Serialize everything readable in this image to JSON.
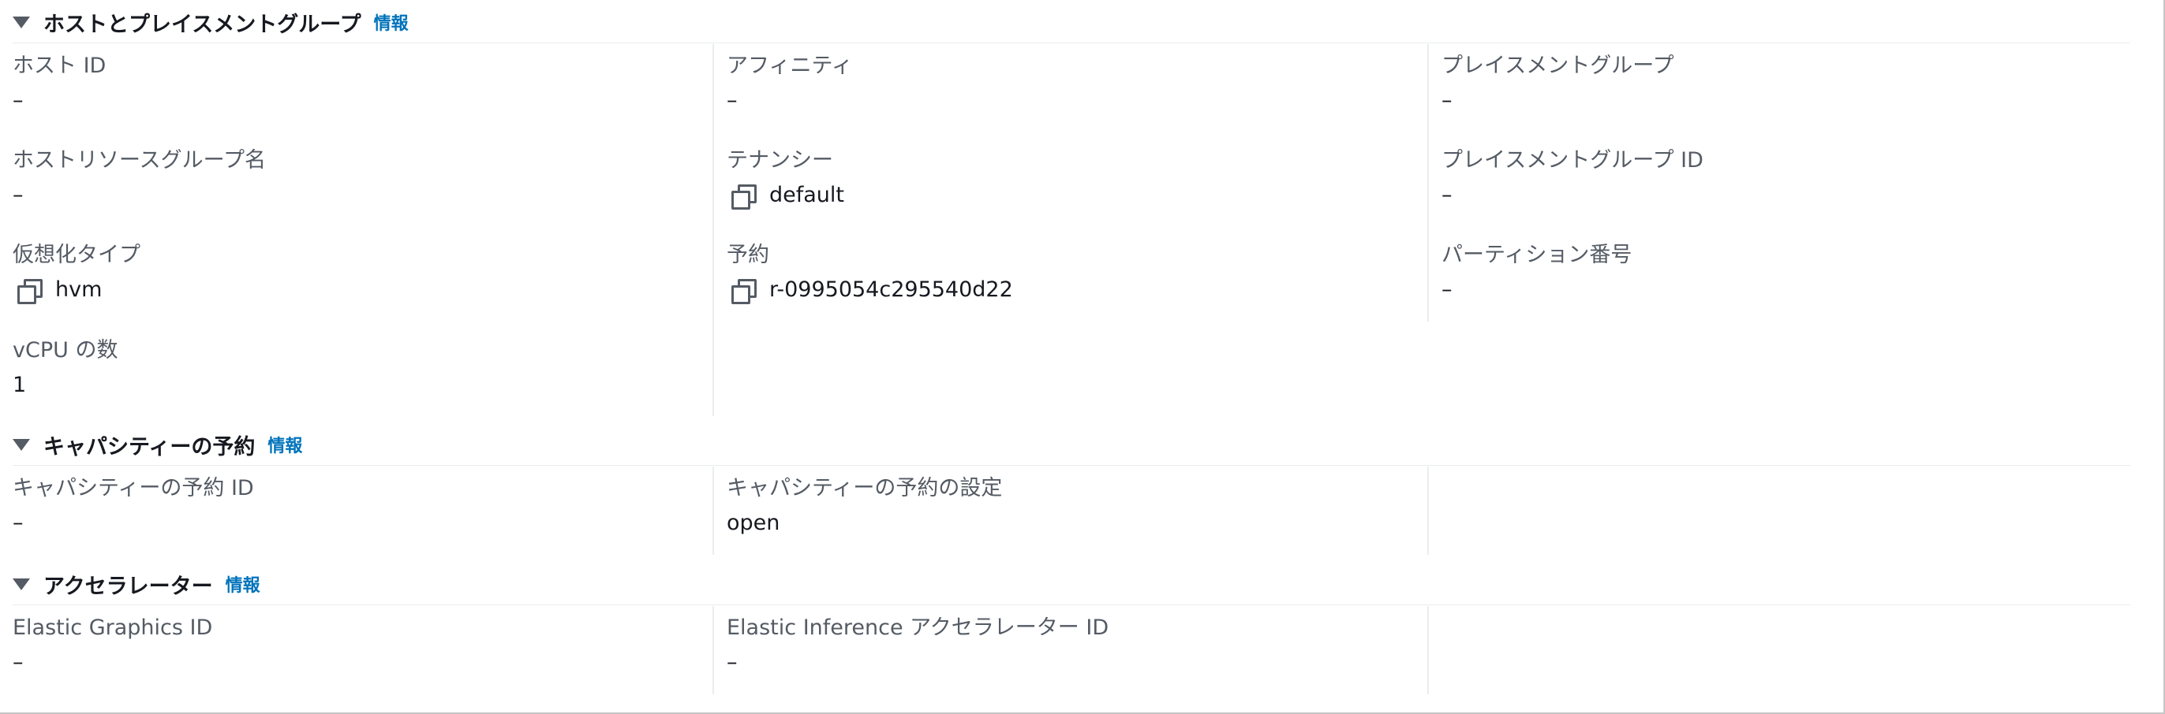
{
  "sections": {
    "host": {
      "title": "ホストとプレイスメントグループ",
      "info": "情報",
      "fields": {
        "host_id": {
          "label": "ホスト ID",
          "value": "–"
        },
        "affinity": {
          "label": "アフィニティ",
          "value": "–"
        },
        "placement_group": {
          "label": "プレイスメントグループ",
          "value": "–"
        },
        "host_resource_group": {
          "label": "ホストリソースグループ名",
          "value": "–"
        },
        "tenancy": {
          "label": "テナンシー",
          "value": "default"
        },
        "placement_group_id": {
          "label": "プレイスメントグループ ID",
          "value": "–"
        },
        "virtualization_type": {
          "label": "仮想化タイプ",
          "value": "hvm"
        },
        "reservation": {
          "label": "予約",
          "value": "r-0995054c295540d22"
        },
        "partition_number": {
          "label": "パーティション番号",
          "value": "–"
        },
        "vcpu_count": {
          "label": "vCPU の数",
          "value": "1"
        }
      }
    },
    "capacity": {
      "title": "キャパシティーの予約",
      "info": "情報",
      "fields": {
        "reservation_id": {
          "label": "キャパシティーの予約 ID",
          "value": "–"
        },
        "reservation_setting": {
          "label": "キャパシティーの予約の設定",
          "value": "open"
        }
      }
    },
    "accelerator": {
      "title": "アクセラレーター",
      "info": "情報",
      "fields": {
        "elastic_graphics_id": {
          "label": "Elastic Graphics ID",
          "value": "–"
        },
        "elastic_inference_id": {
          "label": "Elastic Inference アクセラレーター ID",
          "value": "–"
        }
      }
    }
  },
  "icons": {
    "copy": "copy-icon",
    "expand": "caret-down-icon"
  },
  "colors": {
    "link": "#0073bb",
    "label": "#545b64",
    "value": "#16191f",
    "divider": "#eaeded"
  }
}
